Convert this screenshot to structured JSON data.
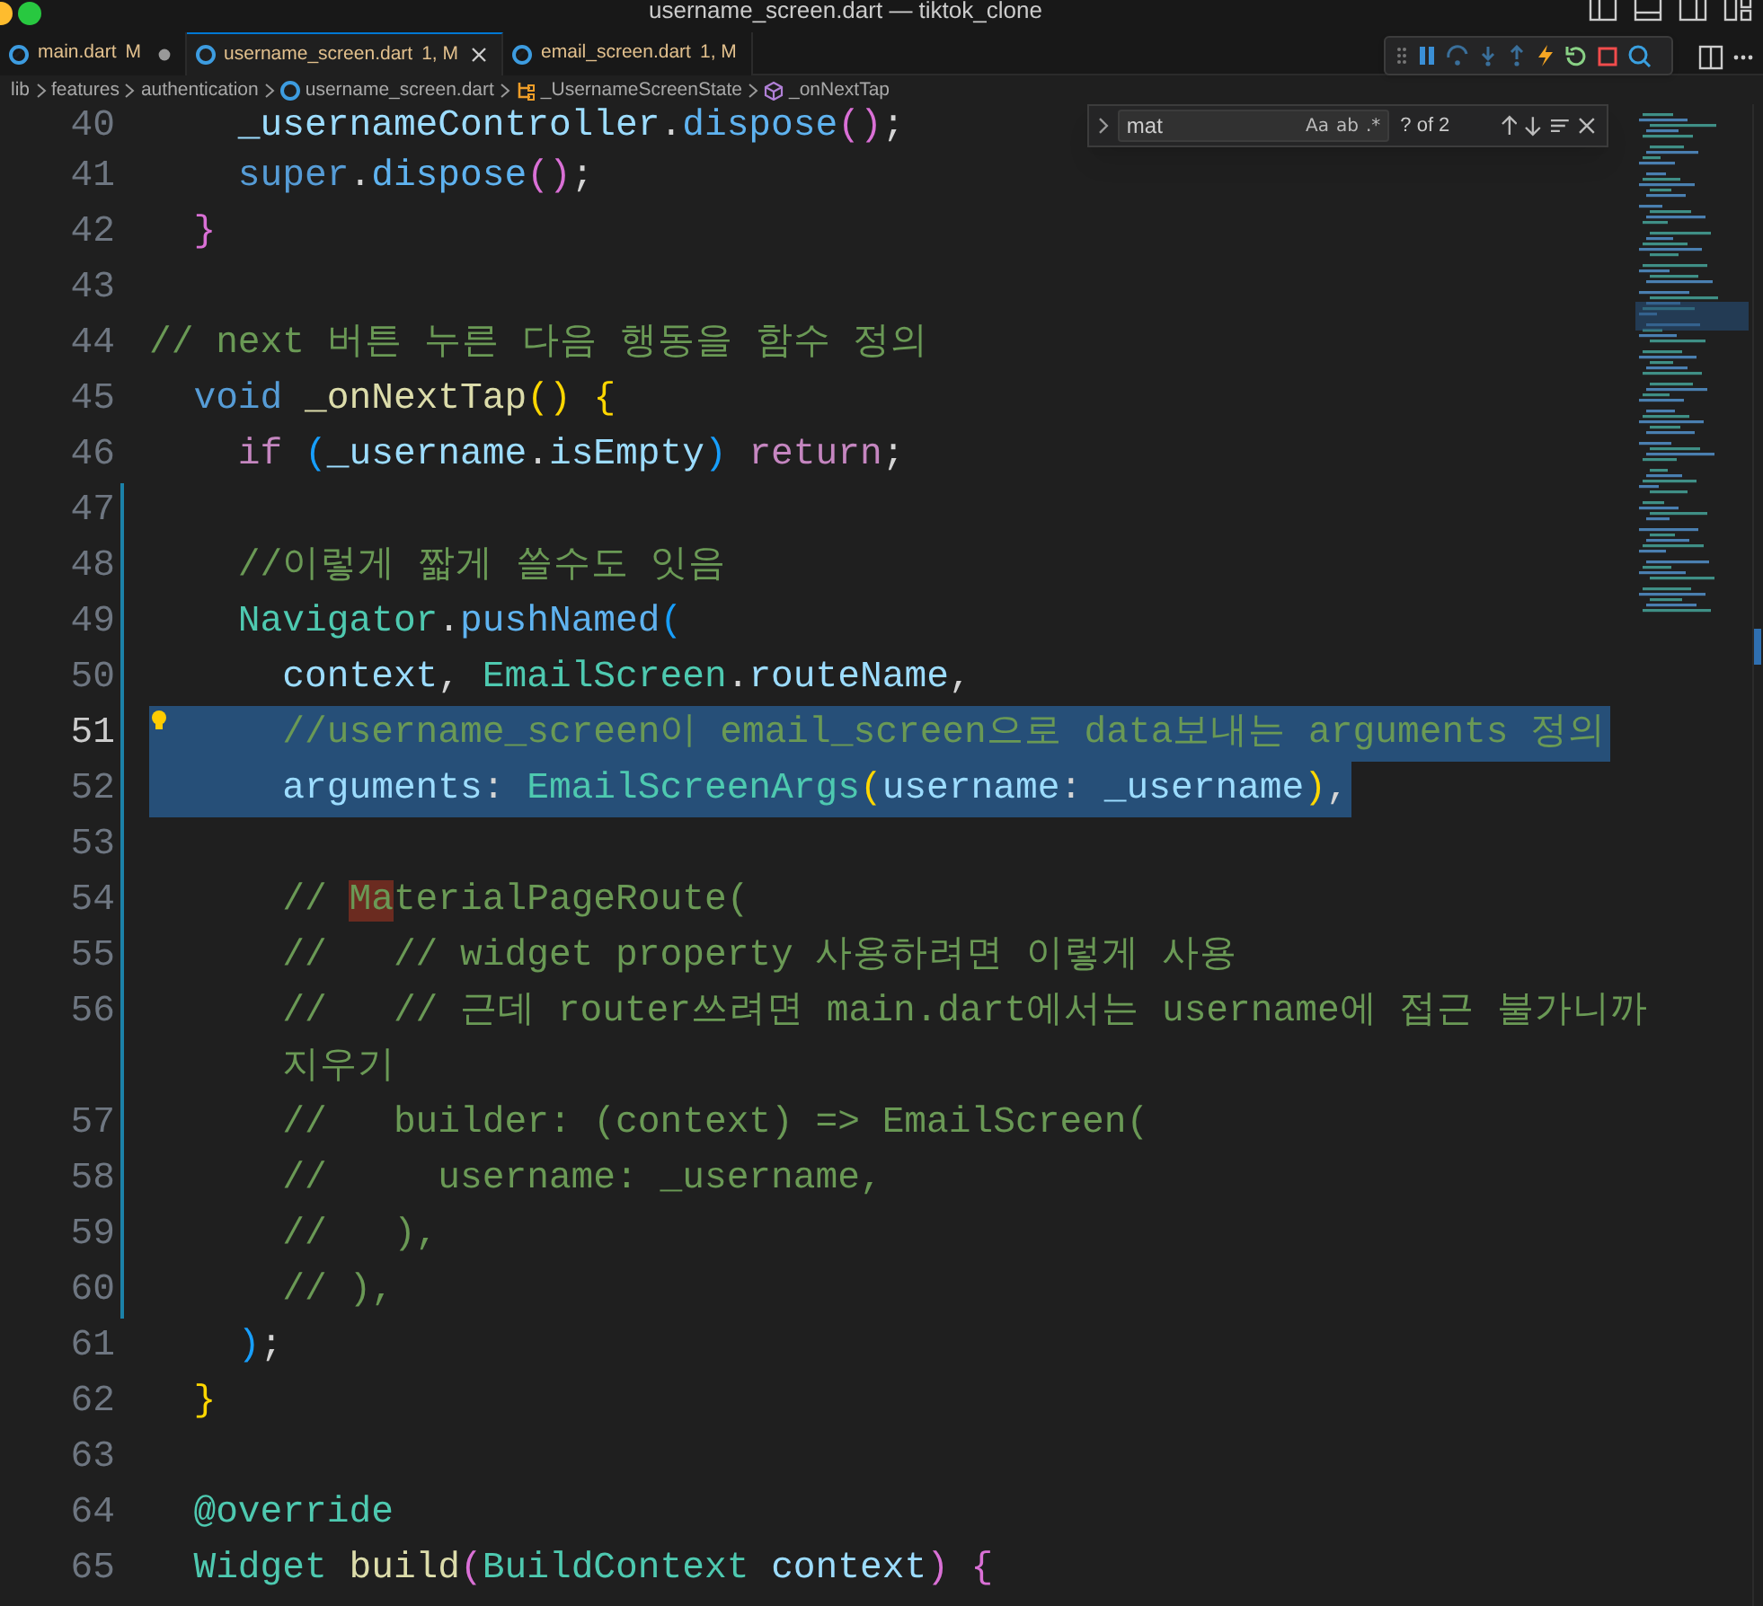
{
  "window": {
    "title": "username_screen.dart — tiktok_clone"
  },
  "tabs": [
    {
      "label": "main.dart",
      "status": "M",
      "selected": false,
      "unsaved": true
    },
    {
      "label": "username_screen.dart",
      "status": "1, M",
      "selected": true,
      "unsaved": false
    },
    {
      "label": "email_screen.dart",
      "status": "1, M",
      "selected": false,
      "unsaved": false
    }
  ],
  "breadcrumbs": [
    {
      "label": "lib",
      "kind": "folder"
    },
    {
      "label": "features",
      "kind": "folder"
    },
    {
      "label": "authentication",
      "kind": "folder"
    },
    {
      "label": "username_screen.dart",
      "kind": "file"
    },
    {
      "label": "_UsernameScreenState",
      "kind": "class"
    },
    {
      "label": "_onNextTap",
      "kind": "method"
    }
  ],
  "find": {
    "value": "mat",
    "options": [
      {
        "label": "Aa"
      },
      {
        "label": "ab"
      },
      {
        "label": ".*"
      }
    ],
    "result": "? of 2"
  },
  "lines": [
    {
      "number": "40",
      "selected": false,
      "current": false,
      "modified": false,
      "rows": [
        [
          {
            "text": "    _usernameController",
            "kind": "var"
          },
          {
            "text": ".",
            "kind": "punct"
          },
          {
            "text": "dispose",
            "kind": "method"
          },
          {
            "text": "()",
            "kind": "bracket2"
          },
          {
            "text": ";",
            "kind": "punct"
          }
        ]
      ]
    },
    {
      "number": "41",
      "selected": false,
      "current": false,
      "modified": false,
      "rows": [
        [
          {
            "text": "    super",
            "kind": "keyword"
          },
          {
            "text": ".",
            "kind": "punct"
          },
          {
            "text": "dispose",
            "kind": "method"
          },
          {
            "text": "()",
            "kind": "bracket2"
          },
          {
            "text": ";",
            "kind": "punct"
          }
        ]
      ]
    },
    {
      "number": "42",
      "selected": false,
      "current": false,
      "modified": false,
      "rows": [
        [
          {
            "text": "  }",
            "kind": "bracket2"
          }
        ]
      ]
    },
    {
      "number": "43",
      "selected": false,
      "current": false,
      "modified": false
    },
    {
      "number": "44",
      "selected": false,
      "current": false,
      "modified": false,
      "rows": [
        [
          {
            "text": "// next 버튼 누른 다음 행동을 함수 정의",
            "kind": "comment"
          }
        ]
      ]
    },
    {
      "number": "45",
      "selected": false,
      "current": false,
      "modified": false,
      "rows": [
        [
          {
            "text": "  void",
            "kind": "keyword"
          },
          {
            "text": " ",
            "kind": "punct"
          },
          {
            "text": "_onNextTap",
            "kind": "function"
          },
          {
            "text": "()",
            "kind": "bracket1"
          },
          {
            "text": " ",
            "kind": "punct"
          },
          {
            "text": "{",
            "kind": "bracket1"
          }
        ]
      ]
    },
    {
      "number": "46",
      "selected": false,
      "current": false,
      "modified": false,
      "rows": [
        [
          {
            "text": "    if",
            "kind": "control"
          },
          {
            "text": " ",
            "kind": "punct"
          },
          {
            "text": "(",
            "kind": "bracket3"
          },
          {
            "text": "_username",
            "kind": "var"
          },
          {
            "text": ".",
            "kind": "punct"
          },
          {
            "text": "isEmpty",
            "kind": "var"
          },
          {
            "text": ")",
            "kind": "bracket3"
          },
          {
            "text": " ",
            "kind": "punct"
          },
          {
            "text": "return",
            "kind": "control"
          },
          {
            "text": ";",
            "kind": "punct"
          }
        ]
      ]
    },
    {
      "number": "47",
      "selected": false,
      "current": false,
      "modified": true
    },
    {
      "number": "48",
      "selected": false,
      "current": false,
      "modified": true,
      "rows": [
        [
          {
            "text": "    //이렇게 짧게 쓸수도 잇음",
            "kind": "comment"
          }
        ]
      ]
    },
    {
      "number": "49",
      "selected": false,
      "current": false,
      "modified": true,
      "rows": [
        [
          {
            "text": "    Navigator",
            "kind": "type"
          },
          {
            "text": ".",
            "kind": "punct"
          },
          {
            "text": "pushNamed",
            "kind": "method"
          },
          {
            "text": "(",
            "kind": "bracket3"
          }
        ]
      ]
    },
    {
      "number": "50",
      "selected": false,
      "current": false,
      "modified": true,
      "rows": [
        [
          {
            "text": "      context",
            "kind": "var"
          },
          {
            "text": ", ",
            "kind": "punct"
          },
          {
            "text": "EmailScreen",
            "kind": "type"
          },
          {
            "text": ".",
            "kind": "punct"
          },
          {
            "text": "routeName",
            "kind": "var"
          },
          {
            "text": ",",
            "kind": "punct"
          }
        ]
      ]
    },
    {
      "number": "51",
      "selected": true,
      "current": true,
      "modified": true,
      "rows": [
        [
          {
            "text": "      //username_screen이 email_screen으로 data보내는 arguments 정의",
            "kind": "comment"
          }
        ]
      ]
    },
    {
      "number": "52",
      "selected": true,
      "current": false,
      "modified": true,
      "rows": [
        [
          {
            "text": "      arguments",
            "kind": "var"
          },
          {
            "text": ": ",
            "kind": "punct"
          },
          {
            "text": "EmailScreenArgs",
            "kind": "type"
          },
          {
            "text": "(",
            "kind": "bracket1"
          },
          {
            "text": "username",
            "kind": "var"
          },
          {
            "text": ": ",
            "kind": "punct"
          },
          {
            "text": "_username",
            "kind": "var"
          },
          {
            "text": ")",
            "kind": "bracket1"
          },
          {
            "text": ",",
            "kind": "punct"
          }
        ]
      ]
    },
    {
      "number": "53",
      "selected": false,
      "current": false,
      "modified": true
    },
    {
      "number": "54",
      "selected": false,
      "current": false,
      "modified": true,
      "rows": [
        [
          {
            "text": "      // ",
            "kind": "comment"
          },
          {
            "text": "Ma",
            "kind": "comment",
            "find_match": true
          },
          {
            "text": "terialPageRoute(",
            "kind": "comment"
          }
        ]
      ]
    },
    {
      "number": "55",
      "selected": false,
      "current": false,
      "modified": true,
      "rows": [
        [
          {
            "text": "      //   // widget property 사용하려면 이렇게 사용",
            "kind": "comment"
          }
        ]
      ]
    },
    {
      "number": "56",
      "selected": false,
      "current": false,
      "modified": true,
      "rows": [
        [
          {
            "text": "      //   // 근데 router쓰려면 main.dart에서는 username에 접근 불가니까",
            "kind": "comment"
          }
        ],
        [
          {
            "text": "      지우기",
            "kind": "comment"
          }
        ]
      ]
    },
    {
      "number": "57",
      "selected": false,
      "current": false,
      "modified": true,
      "rows": [
        [
          {
            "text": "      //   builder: (context) => EmailScreen(",
            "kind": "comment"
          }
        ]
      ]
    },
    {
      "number": "58",
      "selected": false,
      "current": false,
      "modified": true,
      "rows": [
        [
          {
            "text": "      //     username: _username,",
            "kind": "comment"
          }
        ]
      ]
    },
    {
      "number": "59",
      "selected": false,
      "current": false,
      "modified": true,
      "rows": [
        [
          {
            "text": "      //   ),",
            "kind": "comment"
          }
        ]
      ]
    },
    {
      "number": "60",
      "selected": false,
      "current": false,
      "modified": true,
      "rows": [
        [
          {
            "text": "      // ),",
            "kind": "comment"
          }
        ]
      ]
    },
    {
      "number": "61",
      "selected": false,
      "current": false,
      "modified": false,
      "rows": [
        [
          {
            "text": "    )",
            "kind": "bracket3"
          },
          {
            "text": ";",
            "kind": "punct"
          }
        ]
      ]
    },
    {
      "number": "62",
      "selected": false,
      "current": false,
      "modified": false,
      "rows": [
        [
          {
            "text": "  }",
            "kind": "bracket1"
          }
        ]
      ]
    },
    {
      "number": "63",
      "selected": false,
      "current": false,
      "modified": false
    },
    {
      "number": "64",
      "selected": false,
      "current": false,
      "modified": false,
      "rows": [
        [
          {
            "text": "  @override",
            "kind": "type"
          }
        ]
      ]
    },
    {
      "number": "65",
      "selected": false,
      "current": false,
      "modified": false,
      "rows": [
        [
          {
            "text": "  Widget",
            "kind": "type"
          },
          {
            "text": " ",
            "kind": "punct"
          },
          {
            "text": "build",
            "kind": "function"
          },
          {
            "text": "(",
            "kind": "bracket2"
          },
          {
            "text": "BuildContext",
            "kind": "type"
          },
          {
            "text": " ",
            "kind": "punct"
          },
          {
            "text": "context",
            "kind": "var"
          },
          {
            "text": ")",
            "kind": "bracket2"
          },
          {
            "text": " ",
            "kind": "punct"
          },
          {
            "text": "{",
            "kind": "bracket2"
          }
        ]
      ]
    }
  ]
}
